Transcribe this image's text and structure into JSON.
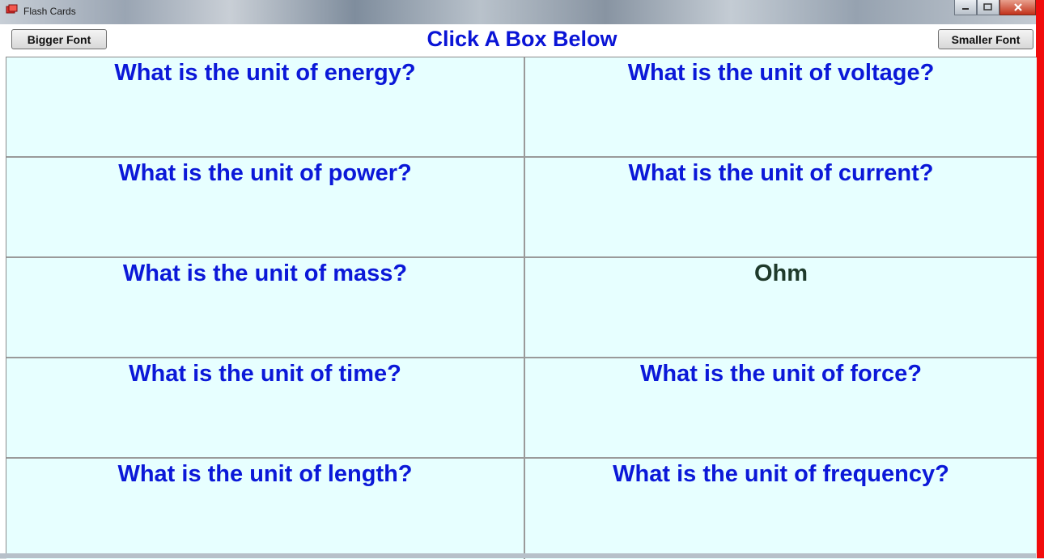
{
  "window": {
    "title": "Flash Cards",
    "accent": "#f10c0c"
  },
  "header": {
    "title": "Click A Box Below",
    "bigger_font_label": "Bigger Font",
    "smaller_font_label": "Smaller Font"
  },
  "cards": [
    {
      "text": "What is the unit of energy?",
      "state": "question"
    },
    {
      "text": "What is the unit of voltage?",
      "state": "question"
    },
    {
      "text": "What is the unit of power?",
      "state": "question"
    },
    {
      "text": "What is the unit of current?",
      "state": "question"
    },
    {
      "text": "What is the unit of mass?",
      "state": "question"
    },
    {
      "text": "Ohm",
      "state": "answer"
    },
    {
      "text": "What is the unit of time?",
      "state": "question"
    },
    {
      "text": "What is the unit of force?",
      "state": "question"
    },
    {
      "text": "What is the unit of length?",
      "state": "question"
    },
    {
      "text": "What is the unit of frequency?",
      "state": "question"
    }
  ],
  "colors": {
    "question_text": "#0b18d8",
    "answer_text": "#1f3a2b",
    "card_background": "#e7ffff"
  }
}
